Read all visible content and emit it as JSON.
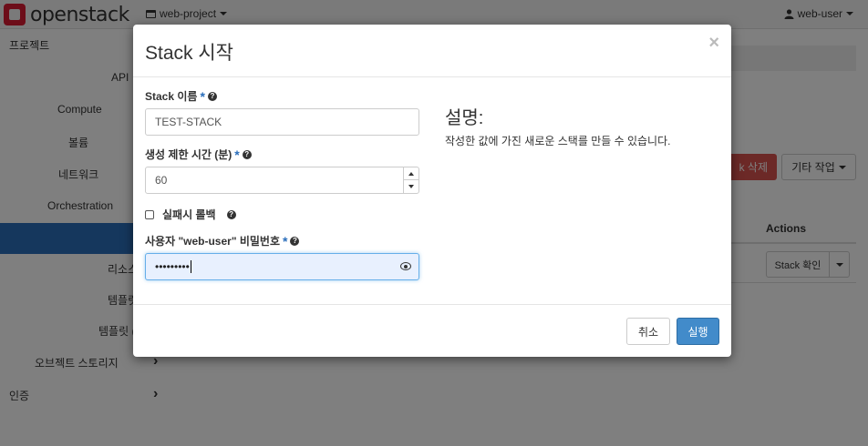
{
  "header": {
    "logo_text": "openstack",
    "project_label": "web-project",
    "user_label": "web-user"
  },
  "sidebar": {
    "items": [
      {
        "label": "프로젝트"
      },
      {
        "label": "API"
      },
      {
        "label": "Compute"
      },
      {
        "label": "볼륨"
      },
      {
        "label": "네트워크"
      },
      {
        "label": "Orchestration"
      },
      {
        "label": "리소스"
      },
      {
        "label": "템플릿"
      },
      {
        "label": "템플릿 ("
      },
      {
        "label": "오브젝트 스토리지"
      },
      {
        "label": "인증"
      }
    ]
  },
  "main": {
    "delete_label": "k 삭제",
    "other_actions_label": "기타 작업",
    "actions_header": "Actions",
    "row_action_label": "Stack 확인"
  },
  "modal": {
    "title": "Stack 시작",
    "close_symbol": "×",
    "stack_name_label": "Stack 이름",
    "stack_name_value": "TEST-STACK",
    "timeout_label": "생성 제한 시간 (분)",
    "timeout_value": "60",
    "rollback_label": "실패시 롤백",
    "password_label": "사용자 \"web-user\" 비밀번호",
    "password_value": "•••••••••",
    "description_title": "설명:",
    "description_text": "작성한 값에 가진 새로운 스택를 만들 수 있습니다.",
    "cancel_label": "취소",
    "submit_label": "실행"
  },
  "icons": [
    "logo-icon",
    "project-icon",
    "user-icon",
    "help-icon",
    "eye-icon",
    "close-icon",
    "chevron-right-icon"
  ],
  "colors": {
    "accent": "#2a6ebb",
    "primary_button": "#428bca",
    "danger_button": "#d9534f",
    "brand": "#da1a32"
  }
}
